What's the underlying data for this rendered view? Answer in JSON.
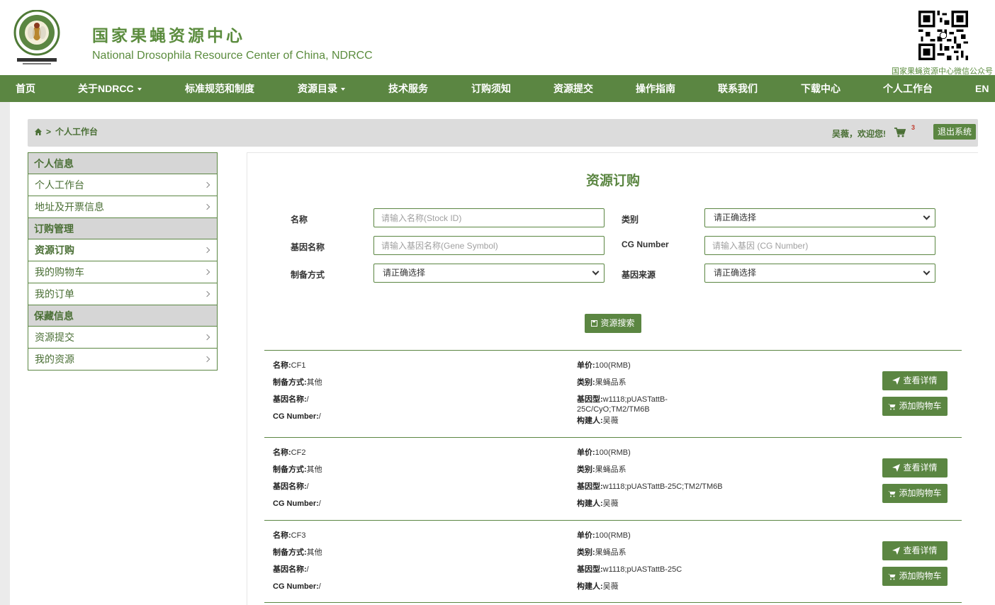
{
  "header": {
    "title_cn": "国家果蝇资源中心",
    "title_en": "National Drosophila Resource Center of China, NDRCC",
    "logo_text": "国家果蝇资源中心",
    "qr_caption": "国家果蝇资源中心微信公众号"
  },
  "nav": [
    {
      "label": "首页",
      "dropdown": false
    },
    {
      "label": "关于NDRCC",
      "dropdown": true
    },
    {
      "label": "标准规范和制度",
      "dropdown": false
    },
    {
      "label": "资源目录",
      "dropdown": true
    },
    {
      "label": "技术服务",
      "dropdown": false
    },
    {
      "label": "订购须知",
      "dropdown": false
    },
    {
      "label": "资源提交",
      "dropdown": false
    },
    {
      "label": "操作指南",
      "dropdown": false
    },
    {
      "label": "联系我们",
      "dropdown": false
    },
    {
      "label": "下载中心",
      "dropdown": false
    },
    {
      "label": "个人工作台",
      "dropdown": false
    },
    {
      "label": "EN",
      "dropdown": false
    }
  ],
  "breadcrumb": {
    "separator": ">",
    "current": "个人工作台"
  },
  "user": {
    "welcome": "吴薇，欢迎您!",
    "cart_count": "3",
    "logout": "退出系统"
  },
  "sidebar": {
    "sections": [
      {
        "title": "个人信息",
        "items": [
          {
            "label": "个人工作台"
          },
          {
            "label": "地址及开票信息"
          }
        ]
      },
      {
        "title": "订购管理",
        "items": [
          {
            "label": "资源订购",
            "active": true
          },
          {
            "label": "我的购物车"
          },
          {
            "label": "我的订单"
          }
        ]
      },
      {
        "title": "保藏信息",
        "items": [
          {
            "label": "资源提交"
          },
          {
            "label": "我的资源"
          }
        ]
      }
    ]
  },
  "form": {
    "title": "资源订购",
    "name_label": "名称",
    "name_placeholder": "请输入名称(Stock ID)",
    "category_label": "类别",
    "category_value": "请正确选择",
    "gene_label": "基因名称",
    "gene_placeholder": "请输入基因名称(Gene Symbol)",
    "cg_label": "CG Number",
    "cg_placeholder": "请输入基因 (CG Number)",
    "method_label": "制备方式",
    "method_value": "请正确选择",
    "source_label": "基因来源",
    "source_value": "请正确选择",
    "search_button": "资源搜索"
  },
  "result_labels": {
    "name": "名称:",
    "method": "制备方式:",
    "gene": "基因名称:",
    "cg": "CG Number:",
    "price": "单价:",
    "category": "类别:",
    "genotype": "基因型:",
    "builder": "构建人:",
    "detail_button": "查看详情",
    "cart_button": "添加购物车"
  },
  "results": [
    {
      "name": "CF1",
      "method": "其他",
      "gene": "/",
      "cg": "/",
      "price": "100(RMB)",
      "category": "果蝇品系",
      "genotype": "w1118;pUASTattB-25C/CyO;TM2/TM6B",
      "builder": "吴薇"
    },
    {
      "name": "CF2",
      "method": "其他",
      "gene": "/",
      "cg": "/",
      "price": "100(RMB)",
      "category": "果蝇品系",
      "genotype": "w1118;pUASTattB-25C;TM2/TM6B",
      "builder": "吴薇"
    },
    {
      "name": "CF3",
      "method": "其他",
      "gene": "/",
      "cg": "/",
      "price": "100(RMB)",
      "category": "果蝇品系",
      "genotype": "w1118;pUASTattB-25C",
      "builder": "吴薇"
    }
  ],
  "colors": {
    "brand_green": "#5b8642",
    "title_green": "#5b8c3e",
    "panel_grey": "#dcdcdc"
  }
}
